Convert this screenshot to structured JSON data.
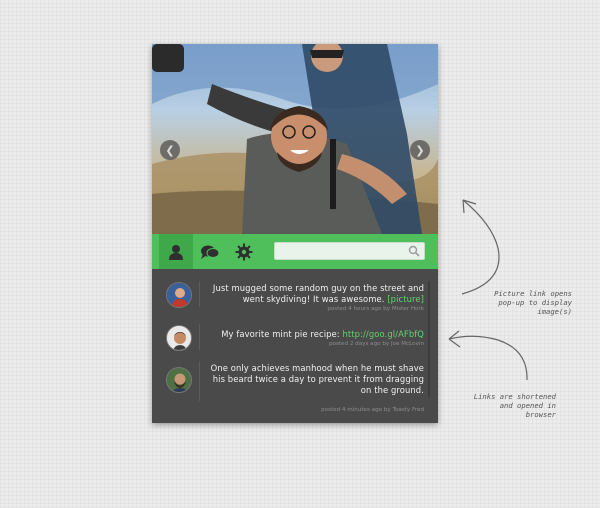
{
  "carousel": {
    "prev_icon": "chevron-left-icon",
    "next_icon": "chevron-right-icon"
  },
  "toolbar": {
    "profile_icon": "user-icon",
    "chat_icon": "chat-bubbles-icon",
    "settings_icon": "gear-icon",
    "search_placeholder": "",
    "accent_color": "#4fbf5b"
  },
  "feed": [
    {
      "text_before": "Just mugged some random guy on the street and went skydiving! It was awesome.",
      "link": "[picture]",
      "meta": "posted 4 hours ago by Mister Hork"
    },
    {
      "text_before": "My favorite mint pie recipe:",
      "link": "http://goo.gl/AFbfQ",
      "meta": "posted 2 days ago by Joe McLovin"
    },
    {
      "text_before": "One only achieves manhood when he must shave his beard twice a day to prevent it from dragging on the ground.",
      "link": "",
      "meta": "posted 4 minutes ago by Toasty Fred"
    }
  ],
  "annotations": {
    "picture_note": [
      "Picture link opens",
      "pop-up to display",
      "image(s)"
    ],
    "links_note": [
      "Links are shortened",
      "and opened in",
      "browser"
    ]
  }
}
